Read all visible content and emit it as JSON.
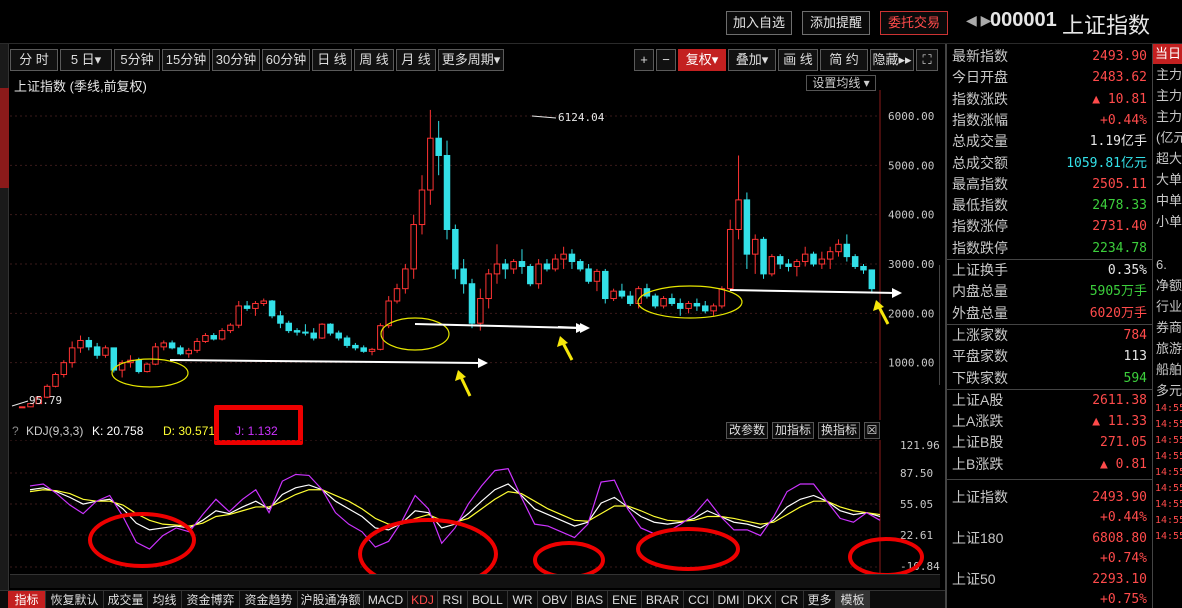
{
  "header": {
    "add_watch": "加入自选",
    "add_alert": "添加提醒",
    "entrust": "委托交易",
    "code": "000001",
    "name": "上证指数"
  },
  "periods": [
    "分 时",
    "5 日▾",
    "5分钟",
    "15分钟",
    "30分钟",
    "60分钟",
    "日 线",
    "周 线",
    "月 线",
    "更多周期▾"
  ],
  "tools": [
    "+",
    "−",
    "复权▾",
    "叠加▾",
    "画 线",
    "简 约",
    "隐藏▸▸",
    "⛶"
  ],
  "chart": {
    "title": "上证指数 (季线,前复权)",
    "ma_settings": "设置均线 ▾",
    "high_label": "6124.04",
    "low_label": "95.79",
    "y_ticks": [
      "6000.00",
      "5000.00",
      "4000.00",
      "3000.00",
      "2000.00",
      "1000.00"
    ]
  },
  "chart_data": [
    {
      "type": "candlestick",
      "title": "上证指数 (季线,前复权)",
      "yticks": [
        1000,
        2000,
        3000,
        4000,
        5000,
        6000
      ],
      "ylim": [
        0,
        6500
      ],
      "max_label": 6124.04,
      "min_label": 95.79,
      "ohlc": [
        [
          95,
          110,
          95,
          105
        ],
        [
          105,
          180,
          100,
          170
        ],
        [
          170,
          320,
          160,
          300
        ],
        [
          300,
          560,
          280,
          520
        ],
        [
          520,
          800,
          500,
          760
        ],
        [
          760,
          1050,
          700,
          1000
        ],
        [
          1000,
          1430,
          900,
          1300
        ],
        [
          1300,
          1550,
          1200,
          1450
        ],
        [
          1450,
          1520,
          1250,
          1320
        ],
        [
          1320,
          1400,
          1080,
          1150
        ],
        [
          1150,
          1350,
          1100,
          1300
        ],
        [
          1300,
          1300,
          800,
          850
        ],
        [
          850,
          1050,
          700,
          1000
        ],
        [
          1000,
          1150,
          900,
          1050
        ],
        [
          1050,
          1100,
          780,
          820
        ],
        [
          820,
          1000,
          800,
          970
        ],
        [
          970,
          1400,
          950,
          1320
        ],
        [
          1320,
          1450,
          1250,
          1400
        ],
        [
          1400,
          1450,
          1270,
          1300
        ],
        [
          1300,
          1350,
          1150,
          1180
        ],
        [
          1180,
          1300,
          1100,
          1250
        ],
        [
          1250,
          1500,
          1200,
          1430
        ],
        [
          1430,
          1600,
          1400,
          1550
        ],
        [
          1550,
          1600,
          1450,
          1480
        ],
        [
          1480,
          1700,
          1450,
          1650
        ],
        [
          1650,
          1800,
          1600,
          1760
        ],
        [
          1760,
          2250,
          1700,
          2150
        ],
        [
          2150,
          2250,
          2050,
          2100
        ],
        [
          2100,
          2250,
          1950,
          2200
        ],
        [
          2200,
          2300,
          2150,
          2250
        ],
        [
          2250,
          2270,
          1900,
          1950
        ],
        [
          1950,
          2050,
          1700,
          1800
        ],
        [
          1800,
          1850,
          1600,
          1650
        ],
        [
          1650,
          1700,
          1550,
          1620
        ],
        [
          1620,
          1780,
          1550,
          1600
        ],
        [
          1600,
          1700,
          1450,
          1500
        ],
        [
          1500,
          1800,
          1480,
          1780
        ],
        [
          1780,
          1800,
          1550,
          1600
        ],
        [
          1600,
          1650,
          1450,
          1500
        ],
        [
          1500,
          1550,
          1300,
          1350
        ],
        [
          1350,
          1400,
          1250,
          1300
        ],
        [
          1300,
          1350,
          1200,
          1230
        ],
        [
          1230,
          1300,
          1150,
          1270
        ],
        [
          1270,
          1800,
          1250,
          1750
        ],
        [
          1750,
          2350,
          1700,
          2250
        ],
        [
          2250,
          2600,
          2200,
          2500
        ],
        [
          2500,
          3000,
          2400,
          2900
        ],
        [
          2900,
          4000,
          2700,
          3800
        ],
        [
          3800,
          4800,
          3600,
          4500
        ],
        [
          4500,
          6124,
          4200,
          5550
        ],
        [
          5550,
          5900,
          4800,
          5200
        ],
        [
          5200,
          5500,
          3500,
          3700
        ],
        [
          3700,
          3800,
          2700,
          2900
        ],
        [
          2900,
          3100,
          2400,
          2600
        ],
        [
          2600,
          2700,
          1700,
          1800
        ],
        [
          1800,
          2500,
          1650,
          2300
        ],
        [
          2300,
          2900,
          2100,
          2800
        ],
        [
          2800,
          3400,
          2600,
          3000
        ],
        [
          3000,
          3100,
          2700,
          2900
        ],
        [
          2900,
          3100,
          2800,
          3050
        ],
        [
          3050,
          3300,
          2800,
          2950
        ],
        [
          2950,
          3000,
          2550,
          2600
        ],
        [
          2600,
          3100,
          2500,
          3000
        ],
        [
          3000,
          3100,
          2850,
          2900
        ],
        [
          2900,
          3200,
          2850,
          3100
        ],
        [
          3100,
          3350,
          2900,
          3200
        ],
        [
          3200,
          3300,
          2900,
          3050
        ],
        [
          3050,
          3100,
          2850,
          2900
        ],
        [
          2900,
          3000,
          2600,
          2650
        ],
        [
          2650,
          2900,
          2450,
          2850
        ],
        [
          2850,
          2900,
          2200,
          2300
        ],
        [
          2300,
          2500,
          2250,
          2450
        ],
        [
          2450,
          2600,
          2300,
          2350
        ],
        [
          2350,
          2450,
          2150,
          2200
        ],
        [
          2200,
          2550,
          2100,
          2500
        ],
        [
          2500,
          2600,
          2300,
          2350
        ],
        [
          2350,
          2400,
          2100,
          2150
        ],
        [
          2150,
          2350,
          2100,
          2300
        ],
        [
          2300,
          2400,
          2150,
          2200
        ],
        [
          2200,
          2300,
          1950,
          2100
        ],
        [
          2100,
          2250,
          2000,
          2200
        ],
        [
          2200,
          2300,
          2050,
          2150
        ],
        [
          2150,
          2250,
          2000,
          2050
        ],
        [
          2050,
          2200,
          1950,
          2150
        ],
        [
          2150,
          2550,
          2100,
          2500
        ],
        [
          2500,
          3900,
          2450,
          3700
        ],
        [
          3700,
          5200,
          3500,
          4300
        ],
        [
          4300,
          4450,
          2900,
          3200
        ],
        [
          3200,
          3600,
          2800,
          3500
        ],
        [
          3500,
          3550,
          2700,
          2800
        ],
        [
          2800,
          3200,
          2750,
          3150
        ],
        [
          3150,
          3200,
          2900,
          3000
        ],
        [
          3000,
          3100,
          2850,
          2950
        ],
        [
          2950,
          3100,
          2750,
          3050
        ],
        [
          3050,
          3350,
          2950,
          3200
        ],
        [
          3200,
          3250,
          2950,
          3000
        ],
        [
          3000,
          3250,
          2900,
          3100
        ],
        [
          3100,
          3350,
          2900,
          3250
        ],
        [
          3250,
          3500,
          3150,
          3400
        ],
        [
          3400,
          3600,
          3050,
          3150
        ],
        [
          3150,
          3200,
          2900,
          2950
        ],
        [
          2950,
          3000,
          2800,
          2880
        ],
        [
          2880,
          2890,
          2400,
          2500
        ]
      ],
      "markers": {
        "arrows_white": 4,
        "arrows_yellow": 4,
        "ellipses_yellow": 3
      }
    },
    {
      "type": "line",
      "title": "KDJ(9,3,3)",
      "yticks": [
        -10.84,
        22.61,
        55.05,
        87.5,
        121.96
      ],
      "ylim": [
        -12,
        125
      ],
      "series": [
        {
          "name": "K",
          "color": "#ffffff",
          "values": [
            70,
            72,
            68,
            62,
            55,
            58,
            60,
            50,
            35,
            28,
            30,
            32,
            30,
            38,
            48,
            45,
            52,
            58,
            50,
            65,
            72,
            75,
            70,
            58,
            50,
            42,
            30,
            28,
            35,
            48,
            46,
            30,
            34,
            45,
            58,
            70,
            76,
            64,
            50,
            44,
            38,
            32,
            36,
            56,
            62,
            52,
            42,
            36,
            34,
            36,
            40,
            48,
            42,
            36,
            34,
            30,
            38,
            52,
            60,
            64,
            58,
            48,
            44,
            46,
            42
          ]
        },
        {
          "name": "D",
          "color": "#ffff33",
          "values": [
            68,
            70,
            69,
            66,
            60,
            58,
            58,
            54,
            45,
            38,
            34,
            33,
            32,
            35,
            42,
            44,
            48,
            52,
            52,
            58,
            65,
            70,
            70,
            64,
            58,
            50,
            40,
            34,
            34,
            40,
            44,
            38,
            36,
            40,
            50,
            60,
            68,
            66,
            58,
            50,
            44,
            38,
            37,
            45,
            53,
            53,
            48,
            42,
            38,
            37,
            38,
            42,
            42,
            40,
            37,
            34,
            36,
            44,
            52,
            58,
            58,
            52,
            48,
            46,
            44
          ]
        },
        {
          "name": "J",
          "color": "#cc33ff",
          "values": [
            74,
            76,
            66,
            54,
            45,
            58,
            64,
            42,
            15,
            8,
            22,
            30,
            26,
            44,
            60,
            47,
            60,
            70,
            46,
            79,
            86,
            85,
            70,
            46,
            34,
            26,
            10,
            16,
            37,
            64,
            50,
            14,
            30,
            55,
            74,
            90,
            92,
            62,
            34,
            32,
            26,
            20,
            34,
            78,
            80,
            50,
            30,
            24,
            26,
            34,
            44,
            60,
            42,
            28,
            28,
            22,
            42,
            68,
            76,
            76,
            58,
            40,
            36,
            46,
            38
          ]
        }
      ]
    }
  ],
  "kdj": {
    "title": "KDJ(9,3,3)",
    "k": "K: 20.758",
    "d": "D: 30.571",
    "j": "J: 1.132",
    "y_ticks": [
      "121.96",
      "87.50",
      "55.05",
      "22.61",
      "-10.84"
    ],
    "buttons": [
      "改参数",
      "加指标",
      "换指标",
      "☒"
    ]
  },
  "indicator_tabs": [
    "指标",
    "恢复默认",
    "成交量",
    "均线",
    "资金博弈",
    "资金趋势",
    "沪股通净额",
    "MACD",
    "KDJ",
    "RSI",
    "BOLL",
    "WR",
    "OBV",
    "BIAS",
    "ENE",
    "BRAR",
    "CCI",
    "DMI",
    "DKX",
    "CR",
    "更多",
    "模板"
  ],
  "quote": {
    "rows": [
      {
        "label": "最新指数",
        "value": "2493.90",
        "color": "red"
      },
      {
        "label": "今日开盘",
        "value": "2483.62",
        "color": "red"
      },
      {
        "label": "指数涨跌",
        "value": "▲ 10.81",
        "color": "red"
      },
      {
        "label": "指数涨幅",
        "value": "+0.44%",
        "color": "red"
      },
      {
        "label": "总成交量",
        "value": "1.19亿手",
        "color": "white"
      },
      {
        "label": "总成交额",
        "value": "1059.81亿元",
        "color": "cyan"
      },
      {
        "label": "最高指数",
        "value": "2505.11",
        "color": "red"
      },
      {
        "label": "最低指数",
        "value": "2478.33",
        "color": "green"
      },
      {
        "label": "指数涨停",
        "value": "2731.40",
        "color": "red"
      },
      {
        "label": "指数跌停",
        "value": "2234.78",
        "color": "green"
      },
      {
        "label": "上证换手",
        "value": "0.35%",
        "color": "white"
      },
      {
        "label": "内盘总量",
        "value": "5905万手",
        "color": "green"
      },
      {
        "label": "外盘总量",
        "value": "6020万手",
        "color": "red"
      },
      {
        "label": "上涨家数",
        "value": "784",
        "color": "red"
      },
      {
        "label": "平盘家数",
        "value": "113",
        "color": "white"
      },
      {
        "label": "下跌家数",
        "value": "594",
        "color": "green"
      },
      {
        "label": "上证A股",
        "value": "2611.38",
        "color": "red"
      },
      {
        "label": "上A涨跌",
        "value": "▲ 11.33",
        "color": "red"
      },
      {
        "label": "上证B股",
        "value": "271.05",
        "color": "red"
      },
      {
        "label": "上B涨跌",
        "value": "▲ 0.81",
        "color": "red"
      }
    ],
    "indices": [
      {
        "label": "上证指数",
        "value": "2493.90",
        "pct": "+0.44%"
      },
      {
        "label": "上证180",
        "value": "6808.80",
        "pct": "+0.74%"
      },
      {
        "label": "上证50",
        "value": "2293.10",
        "pct": "+0.75%"
      }
    ]
  },
  "side": {
    "header": "当日",
    "items": [
      "主力",
      "主力",
      "主力",
      "(亿元",
      "超大",
      "大单",
      "中单",
      "小单"
    ],
    "extra": [
      "6.",
      "净额",
      "行业",
      "券商",
      "旅游",
      "船舶",
      "多元"
    ],
    "times": [
      "14:55",
      "14:55",
      "14:55",
      "14:55",
      "14:55",
      "14:55",
      "14:55",
      "14:55",
      "14:55"
    ]
  },
  "colors": {
    "up": "#ff3333",
    "down": "#33e0e8",
    "accent": "#c32020"
  }
}
